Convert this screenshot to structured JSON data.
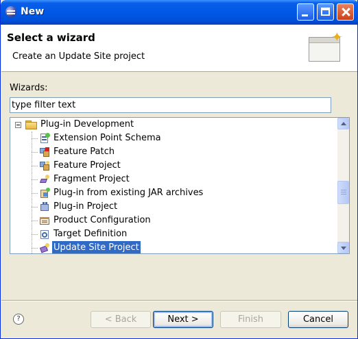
{
  "window": {
    "title": "New"
  },
  "header": {
    "title": "Select a wizard",
    "description": "Create an Update Site project"
  },
  "wizards_label": "Wizards:",
  "filter": {
    "value": "type filter text"
  },
  "tree": {
    "group": {
      "label": "Plug-in Development",
      "expanded": true
    },
    "items": [
      {
        "label": "Extension Point Schema",
        "icon": "extension-point-schema-icon"
      },
      {
        "label": "Feature Patch",
        "icon": "feature-patch-icon"
      },
      {
        "label": "Feature Project",
        "icon": "feature-project-icon"
      },
      {
        "label": "Fragment Project",
        "icon": "fragment-project-icon"
      },
      {
        "label": "Plug-in from existing JAR archives",
        "icon": "plugin-from-jar-icon"
      },
      {
        "label": "Plug-in Project",
        "icon": "plugin-project-icon"
      },
      {
        "label": "Product Configuration",
        "icon": "product-configuration-icon"
      },
      {
        "label": "Target Definition",
        "icon": "target-definition-icon"
      },
      {
        "label": "Update Site Project",
        "icon": "update-site-project-icon",
        "selected": true
      }
    ]
  },
  "buttons": {
    "back": "< Back",
    "next": "Next >",
    "finish": "Finish",
    "cancel": "Cancel"
  },
  "colors": {
    "selection": "#316ac5",
    "titlebar": "#0058e6",
    "dialog_bg": "#ece9d8"
  }
}
